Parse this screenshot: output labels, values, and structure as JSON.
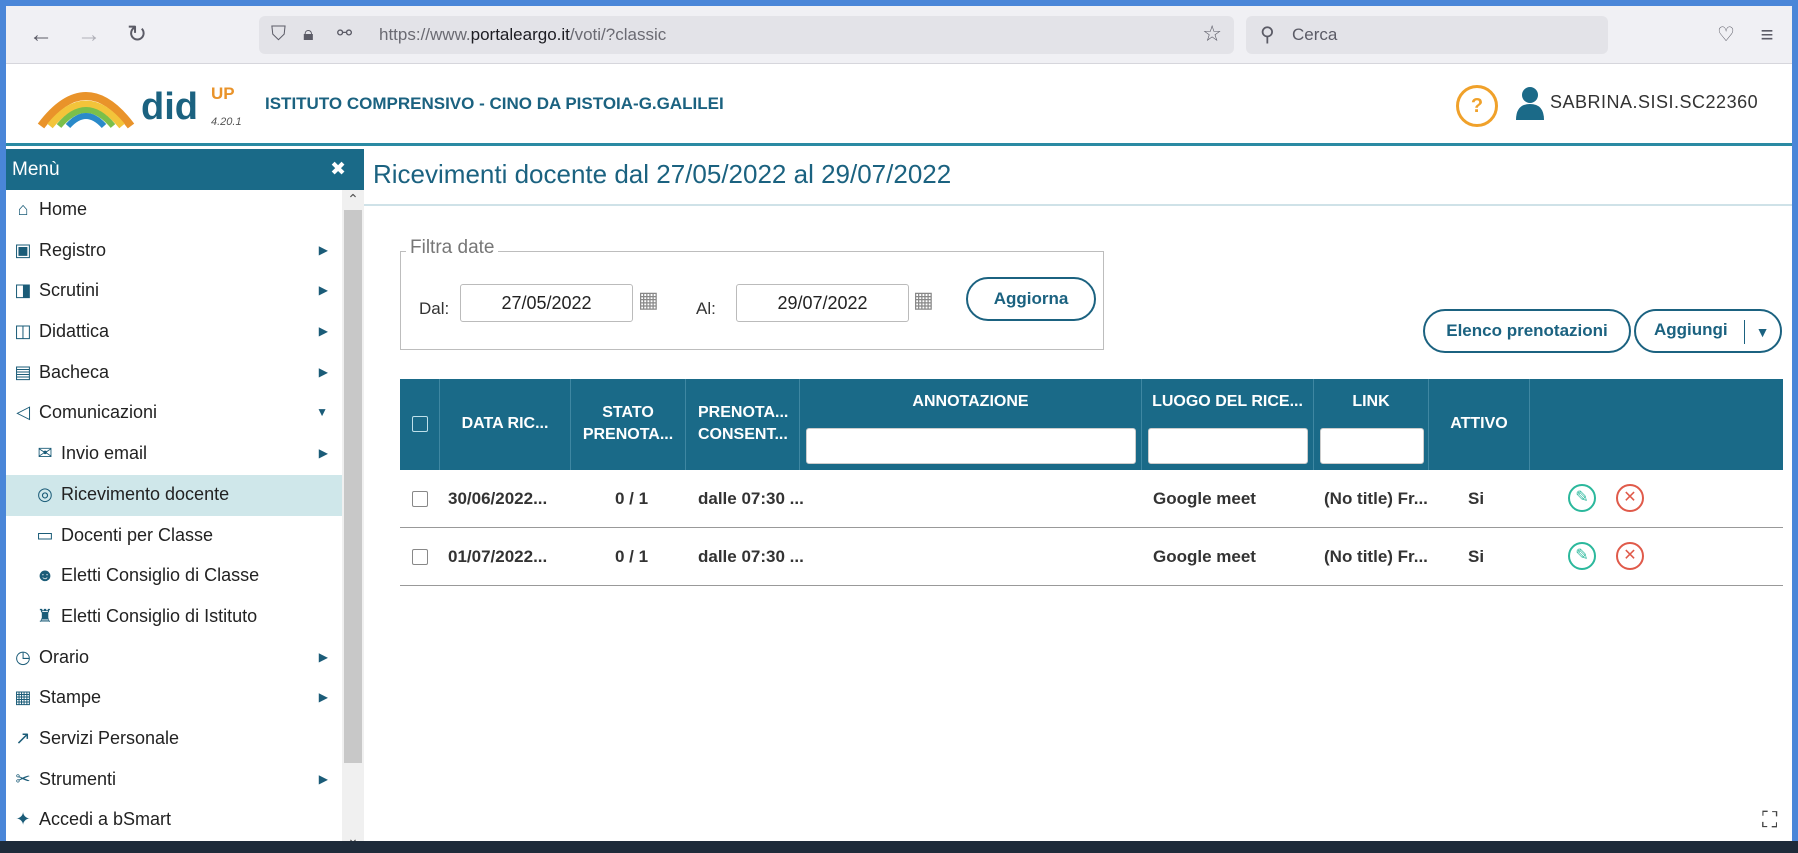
{
  "browser": {
    "url_prefix": "https://www.",
    "url_domain": "portaleargo.it",
    "url_path": "/voti/?classic",
    "search_placeholder": "Cerca"
  },
  "header": {
    "logo_text": "did",
    "logo_sup": "UP",
    "version": "4.20.1",
    "school": "ISTITUTO COMPRENSIVO - CINO DA PISTOIA-G.GALILEI",
    "help": "?",
    "user": "SABRINA.SISI.SC22360"
  },
  "sidebar": {
    "title": "Menù",
    "close": "✖",
    "items": [
      {
        "label": "Home",
        "icon": "⌂",
        "arrow": ""
      },
      {
        "label": "Registro",
        "icon": "▣",
        "arrow": "▶"
      },
      {
        "label": "Scrutini",
        "icon": "◨",
        "arrow": "▶"
      },
      {
        "label": "Didattica",
        "icon": "◫",
        "arrow": "▶"
      },
      {
        "label": "Bacheca",
        "icon": "▤",
        "arrow": "▶"
      },
      {
        "label": "Comunicazioni",
        "icon": "◁",
        "arrow": "▼"
      },
      {
        "label": "Invio email",
        "icon": "✉",
        "arrow": "▶"
      },
      {
        "label": "Ricevimento docente",
        "icon": "◎",
        "arrow": ""
      },
      {
        "label": "Docenti per Classe",
        "icon": "▭",
        "arrow": ""
      },
      {
        "label": "Eletti Consiglio di Classe",
        "icon": "☻",
        "arrow": ""
      },
      {
        "label": "Eletti Consiglio di Istituto",
        "icon": "♜",
        "arrow": ""
      },
      {
        "label": "Orario",
        "icon": "◷",
        "arrow": "▶"
      },
      {
        "label": "Stampe",
        "icon": "▦",
        "arrow": "▶"
      },
      {
        "label": "Servizi Personale",
        "icon": "↗",
        "arrow": ""
      },
      {
        "label": "Strumenti",
        "icon": "✂",
        "arrow": "▶"
      },
      {
        "label": "Accedi a bSmart",
        "icon": "✦",
        "arrow": ""
      }
    ]
  },
  "main": {
    "title": "Ricevimenti docente dal 27/05/2022 al 29/07/2022",
    "filter": {
      "legend": "Filtra date",
      "from_label": "Dal:",
      "from_value": "27/05/2022",
      "to_label": "Al:",
      "to_value": "29/07/2022",
      "refresh": "Aggiorna"
    },
    "buttons": {
      "list": "Elenco prenotazioni",
      "add": "Aggiungi"
    },
    "columns": {
      "data": "DATA RIC...",
      "stato_1": "STATO",
      "stato_2": "PRENOTA...",
      "prenota_1": "PRENOTA...",
      "prenota_2": "CONSENT...",
      "annotazione": "ANNOTAZIONE",
      "luogo": "LUOGO DEL RICE...",
      "link": "LINK",
      "attivo": "ATTIVO"
    },
    "rows": [
      {
        "data": "30/06/2022...",
        "stato": "0 / 1",
        "prenota": "dalle 07:30 ...",
        "annotazione": "",
        "luogo": "Google meet",
        "link": "(No title) Fr...",
        "attivo": "Si"
      },
      {
        "data": "01/07/2022...",
        "stato": "0 / 1",
        "prenota": "dalle 07:30 ...",
        "annotazione": "",
        "luogo": "Google meet",
        "link": "(No title) Fr...",
        "attivo": "Si"
      }
    ]
  },
  "colors": {
    "primary": "#1a6a88",
    "accent": "#f0a12a",
    "edit": "#2bb89c",
    "delete": "#e05a4a"
  }
}
